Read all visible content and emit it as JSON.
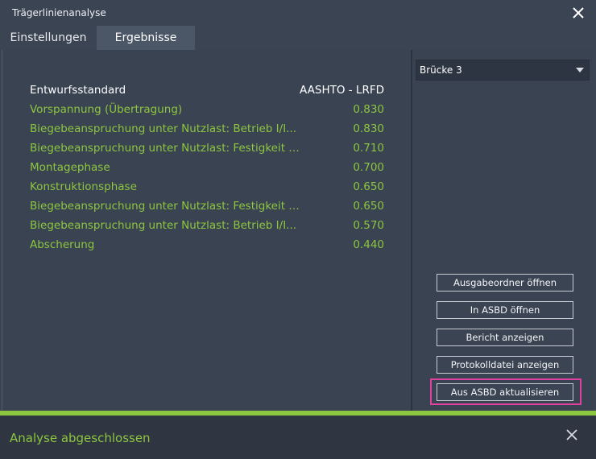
{
  "window": {
    "title": "Trägerlinienanalyse"
  },
  "tabs": [
    {
      "label": "Einstellungen",
      "active": false
    },
    {
      "label": "Ergebnisse",
      "active": true
    }
  ],
  "results": {
    "header": {
      "label": "Entwurfsstandard",
      "value": "AASHTO - LRFD"
    },
    "rows": [
      {
        "label": "Vorspannung (Übertragung)",
        "value": "0.830"
      },
      {
        "label": "Biegebeanspruchung unter Nutzlast: Betrieb I/I...",
        "value": "0.830"
      },
      {
        "label": "Biegebeanspruchung unter Nutzlast: Festigkeit I...",
        "value": "0.710"
      },
      {
        "label": "Montagephase",
        "value": "0.700"
      },
      {
        "label": "Konstruktionsphase",
        "value": "0.650"
      },
      {
        "label": "Biegebeanspruchung unter Nutzlast: Festigkeit I...",
        "value": "0.650"
      },
      {
        "label": "Biegebeanspruchung unter Nutzlast: Betrieb I/I...",
        "value": "0.570"
      },
      {
        "label": "Abscherung",
        "value": "0.440"
      }
    ]
  },
  "bridge_select": {
    "selected": "Brücke 3"
  },
  "actions": {
    "open_output_folder": "Ausgabeordner öffnen",
    "open_in_asbd": "In ASBD öffnen",
    "show_report": "Bericht anzeigen",
    "show_log": "Protokolldatei anzeigen",
    "update_from_asbd": "Aus ASBD aktualisieren"
  },
  "status": {
    "text": "Analyse abgeschlossen"
  },
  "colors": {
    "accent_green": "#8dc63f",
    "highlight": "#e040a0",
    "background": "#3b4453"
  }
}
